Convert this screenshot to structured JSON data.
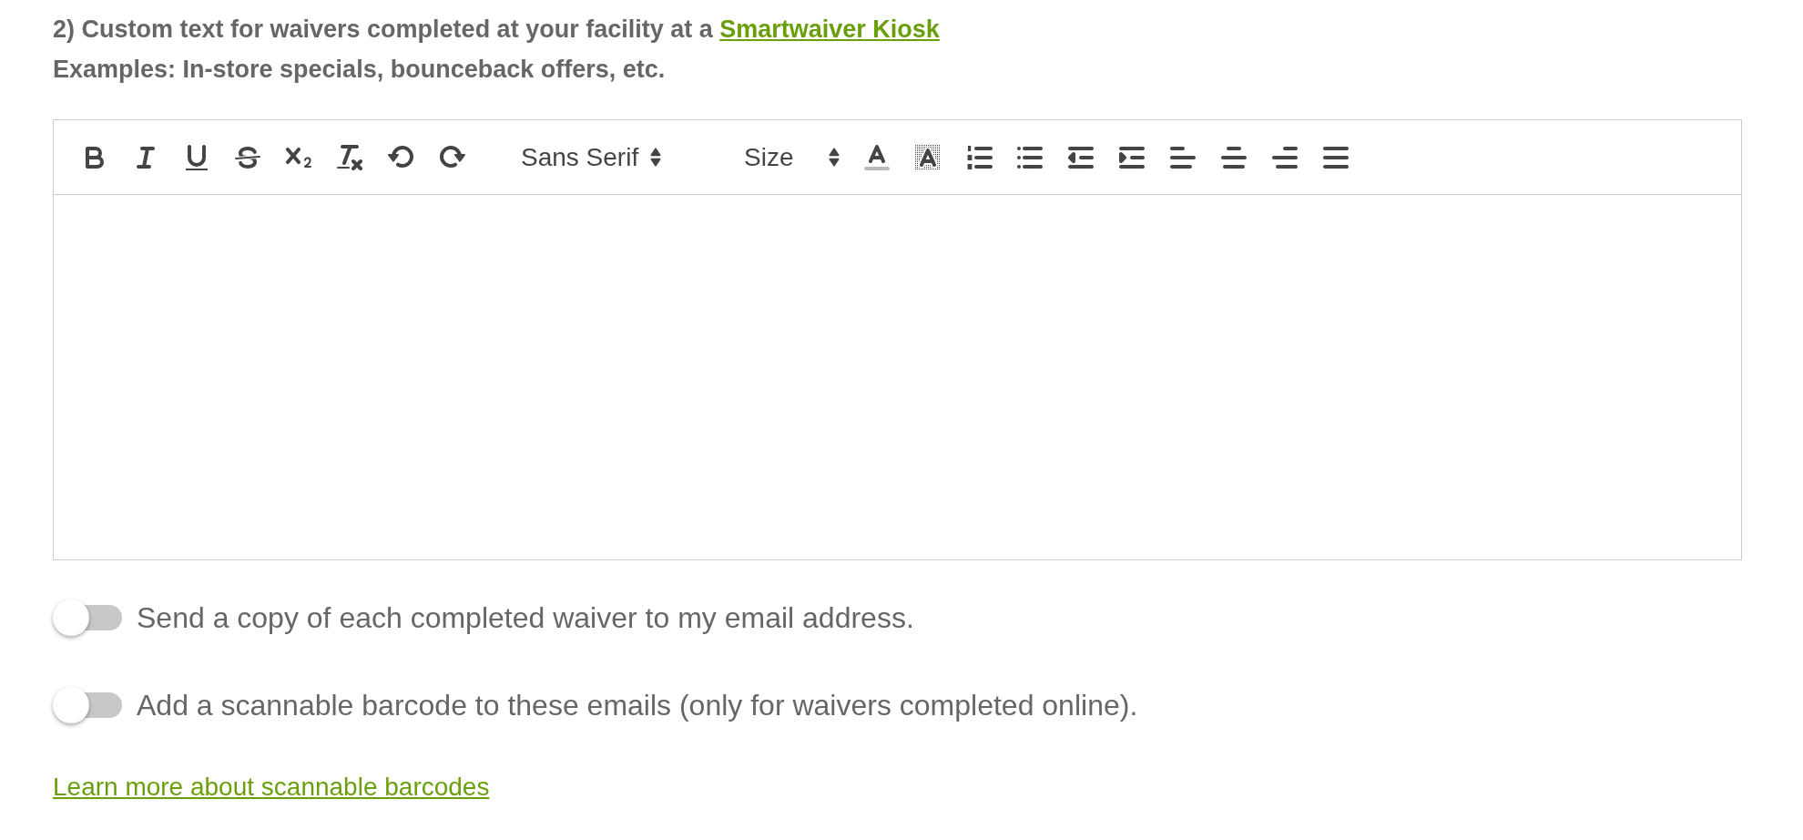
{
  "section_heading": {
    "text": "2) Custom text for waivers completed at your facility at a",
    "link": "Smartwaiver Kiosk"
  },
  "examples": "Examples: In-store specials, bounceback offers, etc.",
  "editor": {
    "font_picker": "Sans Serif",
    "size_picker": "Size"
  },
  "options": [
    {
      "label": "Send a copy of each completed waiver to my email address.",
      "on": false
    },
    {
      "label": "Add a scannable barcode to these emails (only for waivers completed online).",
      "on": false
    }
  ],
  "learn_more_link": "Learn more about scannable barcodes"
}
